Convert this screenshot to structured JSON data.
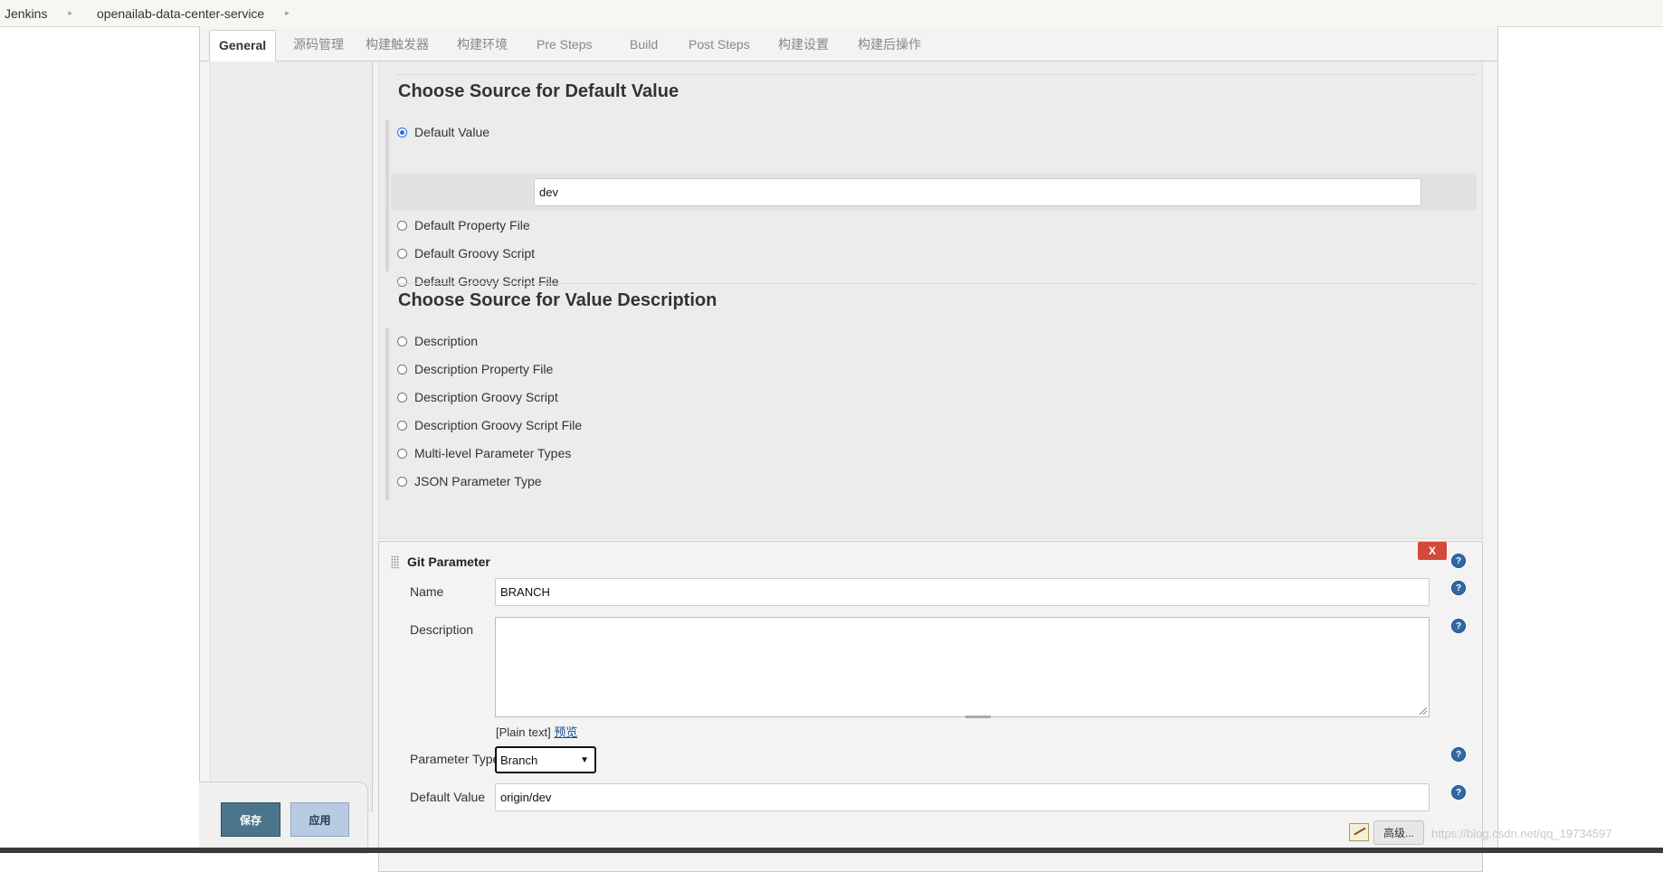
{
  "breadcrumb": [
    "Jenkins",
    "openailab-data-center-service"
  ],
  "tabs": [
    "General",
    "源码管理",
    "构建触发器",
    "构建环境",
    "Pre Steps",
    "Build",
    "Post Steps",
    "构建设置",
    "构建后操作"
  ],
  "default_value_section": {
    "heading": "Choose Source for Default Value",
    "options": [
      "Default Value",
      "Default Property File",
      "Default Groovy Script",
      "Default Groovy Script File"
    ],
    "selected": "Default Value",
    "value": "dev"
  },
  "value_description_section": {
    "heading": "Choose Source for Value Description",
    "options": [
      "Description",
      "Description Property File",
      "Description Groovy Script",
      "Description Groovy Script File",
      "Multi-level Parameter Types",
      "JSON Parameter Type"
    ]
  },
  "git_parameter": {
    "title": "Git Parameter",
    "delete_label": "X",
    "name_label": "Name",
    "name_value": "BRANCH",
    "description_label": "Description",
    "description_value": "",
    "plain_text": "[Plain text]",
    "preview_link": "预览",
    "param_type_label": "Parameter Type",
    "param_type_value": "Branch",
    "default_value_label": "Default Value",
    "default_value": "origin/dev",
    "advanced_label": "高级..."
  },
  "help_icon": "?",
  "buttons": {
    "save": "保存",
    "apply": "应用"
  },
  "watermark": "https://blog.csdn.net/qq_19734597"
}
